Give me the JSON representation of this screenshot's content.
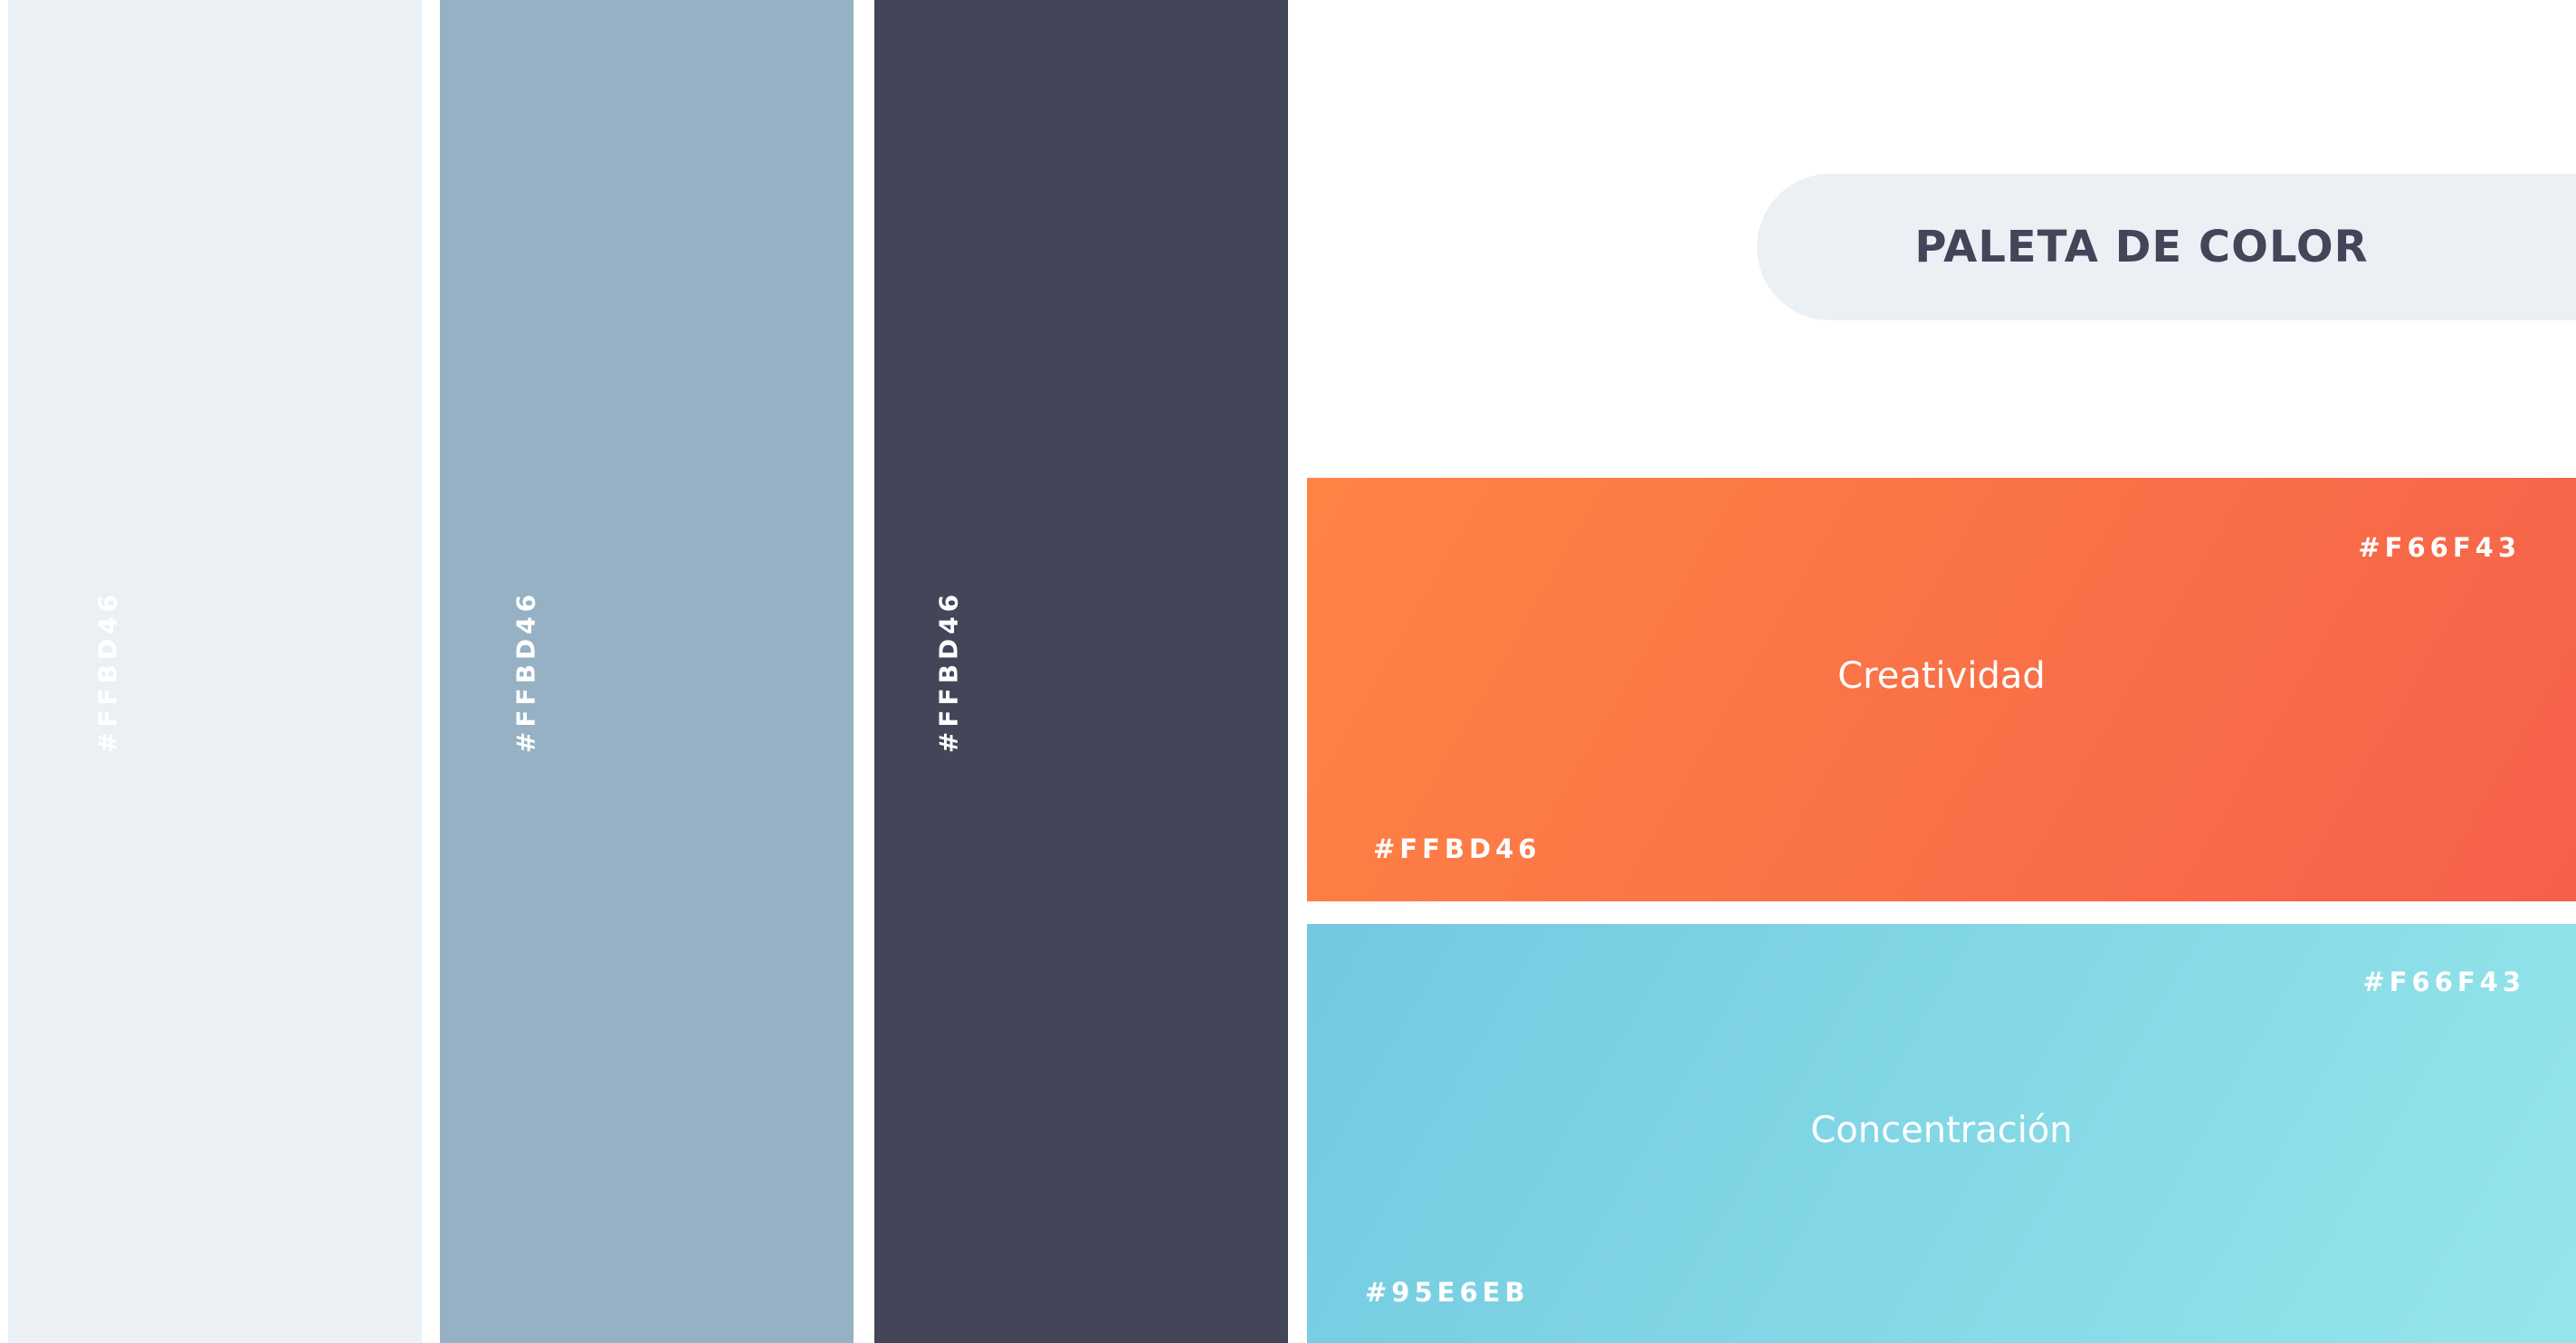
{
  "colors": {
    "strip_1": "#ebf0f5",
    "strip_2": "#95b1c3",
    "strip_3": "#434559",
    "title_pill": "#ebf0f5",
    "title_text": "#434559",
    "creatividad_gradient": [
      "#ff8444",
      "#f5604a"
    ],
    "concentracion_gradient": [
      "#72c9e0",
      "#95e6eb"
    ]
  },
  "strips": [
    {
      "code": "#FFBD46"
    },
    {
      "code": "#FFBD46"
    },
    {
      "code": "#FFBD46"
    }
  ],
  "title": "PALETA DE COLOR",
  "blocks": {
    "creatividad": {
      "label": "Creatividad",
      "code_top": "#F66F43",
      "code_bottom": "#FFBD46"
    },
    "concentracion": {
      "label": "Concentración",
      "code_top": "#F66F43",
      "code_bottom": "#95E6EB"
    }
  }
}
